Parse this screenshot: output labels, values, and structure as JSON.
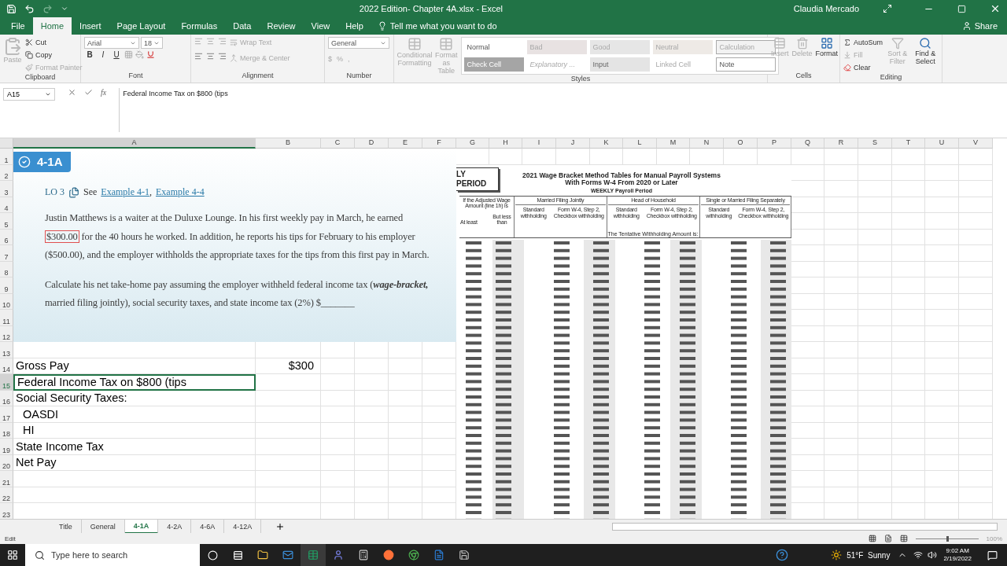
{
  "title_bar": {
    "title": "2022 Edition- Chapter 4A.xlsx  -  Excel",
    "user": "Claudia Mercado"
  },
  "ribbon_tabs": [
    {
      "label": "File",
      "selected": false
    },
    {
      "label": "Home",
      "selected": true
    },
    {
      "label": "Insert",
      "selected": false
    },
    {
      "label": "Page Layout",
      "selected": false
    },
    {
      "label": "Formulas",
      "selected": false
    },
    {
      "label": "Data",
      "selected": false
    },
    {
      "label": "Review",
      "selected": false
    },
    {
      "label": "View",
      "selected": false
    },
    {
      "label": "Help",
      "selected": false
    }
  ],
  "tell_me": "Tell me what you want to do",
  "share": "Share",
  "clipboard": {
    "label": "Clipboard",
    "paste": "Paste",
    "cut": "Cut",
    "copy": "Copy",
    "format_painter": "Format Painter"
  },
  "font": {
    "label": "Font",
    "name": "Arial",
    "size": "18",
    "bold": "B",
    "italic": "I",
    "underline": "U"
  },
  "alignment": {
    "label": "Alignment",
    "wrap": "Wrap Text",
    "merge": "Merge & Center"
  },
  "number": {
    "label": "Number",
    "format": "General",
    "currency": "$",
    "percent": "%",
    "comma": ","
  },
  "styles": {
    "label": "Styles",
    "conditional": "Conditional Formatting",
    "format_table": "Format as Table",
    "cells": [
      {
        "text": "Normal",
        "kind": "normal"
      },
      {
        "text": "Bad",
        "kind": "bad"
      },
      {
        "text": "Good",
        "kind": "good"
      },
      {
        "text": "Neutral",
        "kind": "neutral"
      },
      {
        "text": "Calculation",
        "kind": "calc"
      },
      {
        "text": "Check Cell",
        "kind": "check"
      },
      {
        "text": "Explanatory ...",
        "kind": "explain"
      },
      {
        "text": "Input",
        "kind": "input"
      },
      {
        "text": "Linked Cell",
        "kind": "linked"
      },
      {
        "text": "Note",
        "kind": "note"
      }
    ]
  },
  "cells_group": {
    "label": "Cells",
    "insert": "Insert",
    "delete": "Delete",
    "format": "Format"
  },
  "editing": {
    "label": "Editing",
    "autosum": "AutoSum",
    "fill": "Fill",
    "clear": "Clear",
    "sort": "Sort & Filter",
    "find": "Find & Select"
  },
  "formula_bar": {
    "name_box": "A15",
    "fx": "fx",
    "formula": "Federal Income Tax on $800 (tips"
  },
  "columns": [
    {
      "label": "A",
      "selected": true
    },
    {
      "label": "B",
      "selected": false
    },
    {
      "label": "C",
      "selected": false
    },
    {
      "label": "D",
      "selected": false
    },
    {
      "label": "E",
      "selected": false
    },
    {
      "label": "F",
      "selected": false
    },
    {
      "label": "G",
      "selected": false
    },
    {
      "label": "H",
      "selected": false
    },
    {
      "label": "I",
      "selected": false
    },
    {
      "label": "J",
      "selected": false
    },
    {
      "label": "K",
      "selected": false
    },
    {
      "label": "L",
      "selected": false
    },
    {
      "label": "M",
      "selected": false
    },
    {
      "label": "N",
      "selected": false
    },
    {
      "label": "O",
      "selected": false
    },
    {
      "label": "P",
      "selected": false
    },
    {
      "label": "Q",
      "selected": false
    },
    {
      "label": "R",
      "selected": false
    },
    {
      "label": "S",
      "selected": false
    },
    {
      "label": "T",
      "selected": false
    },
    {
      "label": "U",
      "selected": false
    },
    {
      "label": "V",
      "selected": false
    }
  ],
  "rows": [
    {
      "number": "1",
      "selected": false
    },
    {
      "number": "2",
      "selected": false
    },
    {
      "number": "3",
      "selected": false
    },
    {
      "number": "4",
      "selected": false
    },
    {
      "number": "5",
      "selected": false
    },
    {
      "number": "6",
      "selected": false
    },
    {
      "number": "7",
      "selected": false
    },
    {
      "number": "8",
      "selected": false
    },
    {
      "number": "9",
      "selected": false
    },
    {
      "number": "10",
      "selected": false
    },
    {
      "number": "11",
      "selected": false
    },
    {
      "number": "12",
      "selected": false
    },
    {
      "number": "13",
      "selected": false
    },
    {
      "number": "14",
      "selected": false,
      "cells": [
        {
          "text": "Gross Pay",
          "kind": "text",
          "selected": false
        },
        {
          "text": "$300",
          "kind": "number",
          "selected": false
        }
      ]
    },
    {
      "number": "15",
      "selected": true,
      "cells": [
        {
          "text": "Federal Income Tax on $800 (tips",
          "kind": "text",
          "selected": true
        }
      ]
    },
    {
      "number": "16",
      "selected": false,
      "cells": [
        {
          "text": "Social Security Taxes:",
          "kind": "text",
          "selected": false
        }
      ]
    },
    {
      "number": "17",
      "selected": false,
      "cells": [
        {
          "text": "OASDI",
          "kind": "indent",
          "selected": false
        }
      ]
    },
    {
      "number": "18",
      "selected": false,
      "cells": [
        {
          "text": "HI",
          "kind": "indent",
          "selected": false
        }
      ]
    },
    {
      "number": "19",
      "selected": false,
      "cells": [
        {
          "text": "State Income Tax",
          "kind": "text",
          "selected": false
        }
      ]
    },
    {
      "number": "20",
      "selected": false,
      "cells": [
        {
          "text": "Net Pay",
          "kind": "text",
          "selected": false
        }
      ]
    },
    {
      "number": "21",
      "selected": false
    },
    {
      "number": "22",
      "selected": false
    },
    {
      "number": "23",
      "selected": false
    }
  ],
  "problem": {
    "badge": "4-1A",
    "lo": "LO 3",
    "see": "See",
    "links": [
      "Example 4-1",
      "Example 4-4"
    ],
    "separator": ",",
    "paragraph_1": {
      "before": "Justin Matthews is a waiter at the Duluxe Lounge. In his first weekly pay in March, he earned",
      "boxed": "$300.00",
      "after": "for the 40 hours he worked. In addition, he reports his tips for February to his employer ($500.00), and the employer withholds the appropriate taxes for the tips from this first pay in March."
    },
    "paragraph_2": "Calculate his net take-home pay assuming the employer withheld federal income tax (*wage-bracket,* married filing jointly), social security taxes, and state income tax (2%) $_______"
  },
  "wage_table": {
    "period": [
      "LY",
      "PERIOD"
    ],
    "title": [
      "2021 Wage Bracket Method Tables for Manual Payroll Systems",
      "With Forms W-4 From 2020 or Later"
    ],
    "subtitle": "WEEKLY Payroll Period",
    "range_head": "If the Adjusted Wage Amount (line 1h) is",
    "at_least": "At least",
    "but_less": "But less than",
    "groups": [
      {
        "name": "Married Filing Jointly",
        "standard": "Standard withholding",
        "checkbox": "Form W-4, Step 2, Checkbox withholding"
      },
      {
        "name": "Head of Household",
        "standard": "Standard withholding",
        "checkbox": "Form W-4, Step 2, Checkbox withholding"
      },
      {
        "name": "Single or Married Filing Separately",
        "standard": "Standard withholding",
        "checkbox": "Form W-4, Step 2, Checkbox withholding"
      }
    ],
    "tentative": "The Tentative Withholding Amount is:"
  },
  "sheet_tabs": [
    {
      "label": "Title",
      "selected": false
    },
    {
      "label": "General",
      "selected": false
    },
    {
      "label": "4-1A",
      "selected": true
    },
    {
      "label": "4-2A",
      "selected": false
    },
    {
      "label": "4-6A",
      "selected": false
    },
    {
      "label": "4-12A",
      "selected": false
    }
  ],
  "status_bar": {
    "mode": "Edit",
    "zoom": "100%",
    "zoom_slider": {
      "level": 0.5
    }
  },
  "taskbar": {
    "search": "Type here to search",
    "weather": "51°F  Sunny",
    "time": "9:02 AM",
    "date": "2/19/2022"
  }
}
